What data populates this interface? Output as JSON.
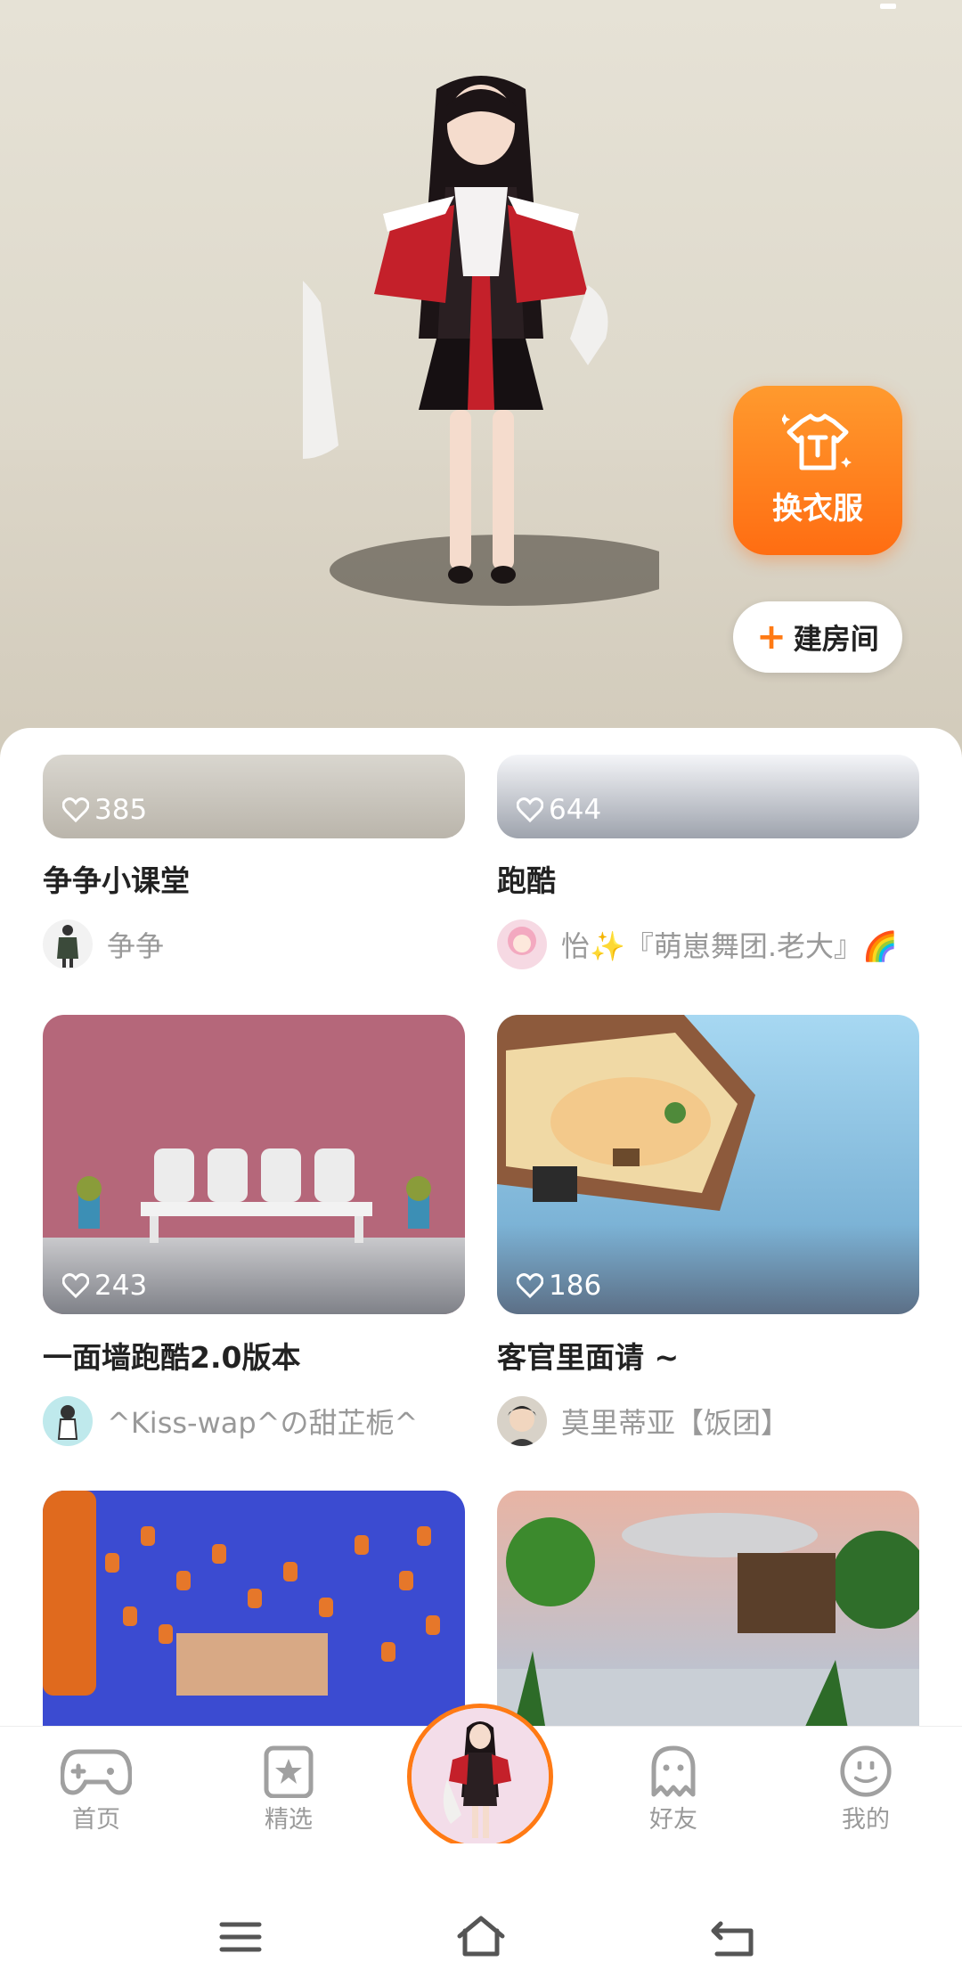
{
  "hero": {
    "outfit_label": "换衣服",
    "outfit_icon": "shirt-icon",
    "create_room_label": "建房间",
    "create_room_icon": "plus-icon"
  },
  "feed": {
    "cards": [
      {
        "likes": "385",
        "title": "争争小课堂",
        "author": "争争"
      },
      {
        "likes": "644",
        "title": "跑酷",
        "author": "怡✨『萌崽舞团.老大』🌈"
      },
      {
        "likes": "243",
        "title": "一面墙跑酷2.0版本",
        "author": "^Kiss-wap^の甜芷栀^"
      },
      {
        "likes": "186",
        "title": "客官里面请 ~",
        "author": "莫里蒂亚【饭团】"
      }
    ]
  },
  "nav": {
    "items": [
      {
        "label": "首页",
        "icon": "gamepad-icon"
      },
      {
        "label": "精选",
        "icon": "star-bookmark-icon"
      },
      {
        "label": "",
        "icon": "avatar"
      },
      {
        "label": "好友",
        "icon": "ghost-icon"
      },
      {
        "label": "我的",
        "icon": "smiley-icon"
      }
    ]
  },
  "system_nav": [
    "menu-icon",
    "home-icon",
    "back-icon"
  ],
  "colors": {
    "accent": "#ff7a14",
    "muted": "#9a9a9a",
    "text": "#222222"
  }
}
